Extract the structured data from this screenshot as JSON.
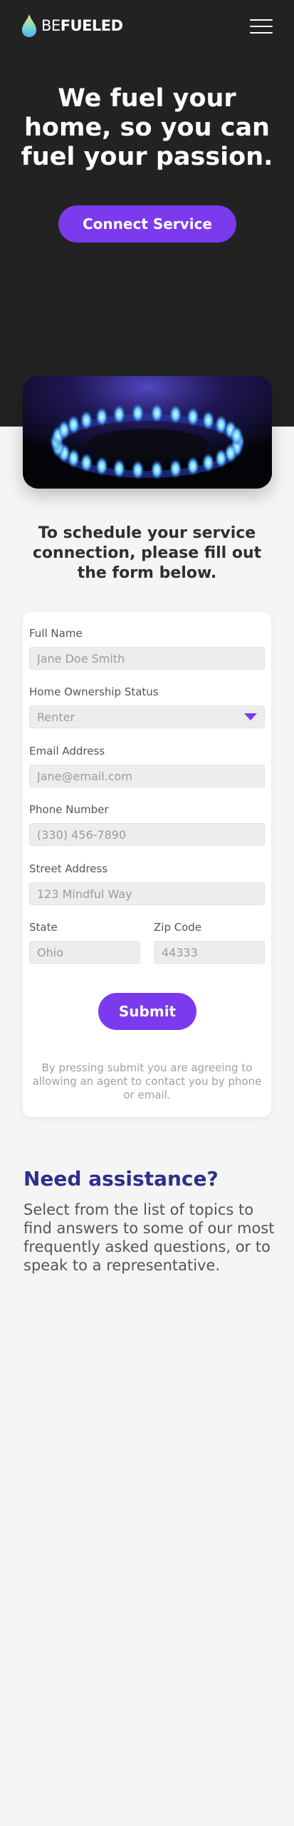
{
  "header": {
    "logo_light": "BE",
    "logo_bold": "FUELED",
    "menu_icon": "hamburger-menu-icon"
  },
  "hero": {
    "title": "We fuel your home, so you can fuel your passion.",
    "cta_label": "Connect Service",
    "image_icon": "gas-burner-flame-image"
  },
  "schedule": {
    "heading": "To schedule your service connection, please fill out the form below."
  },
  "form": {
    "full_name": {
      "label": "Full Name",
      "placeholder": "Jane Doe Smith"
    },
    "ownership": {
      "label": "Home Ownership Status",
      "value": "Renter",
      "icon": "chevron-down-icon"
    },
    "email": {
      "label": "Email Address",
      "placeholder": "Jane@email.com"
    },
    "phone": {
      "label": "Phone Number",
      "placeholder": "(330) 456-7890"
    },
    "street": {
      "label": "Street Address",
      "placeholder": "123 Mindful Way"
    },
    "state": {
      "label": "State",
      "placeholder": "Ohio"
    },
    "zip": {
      "label": "Zip Code",
      "placeholder": "44333"
    },
    "submit_label": "Submit",
    "disclaimer": "By pressing submit you are agreeing to allowing an agent to contact you by phone or email."
  },
  "assistance": {
    "heading": "Need assistance?",
    "text": "Select from the list of topics to find answers to some of our most frequently asked questions, or to speak to a representative."
  },
  "colors": {
    "hero_bg": "#222222",
    "accent": "#7b3aed",
    "assist_heading": "#2e2e8e",
    "page_bg": "#f5f5f6"
  }
}
